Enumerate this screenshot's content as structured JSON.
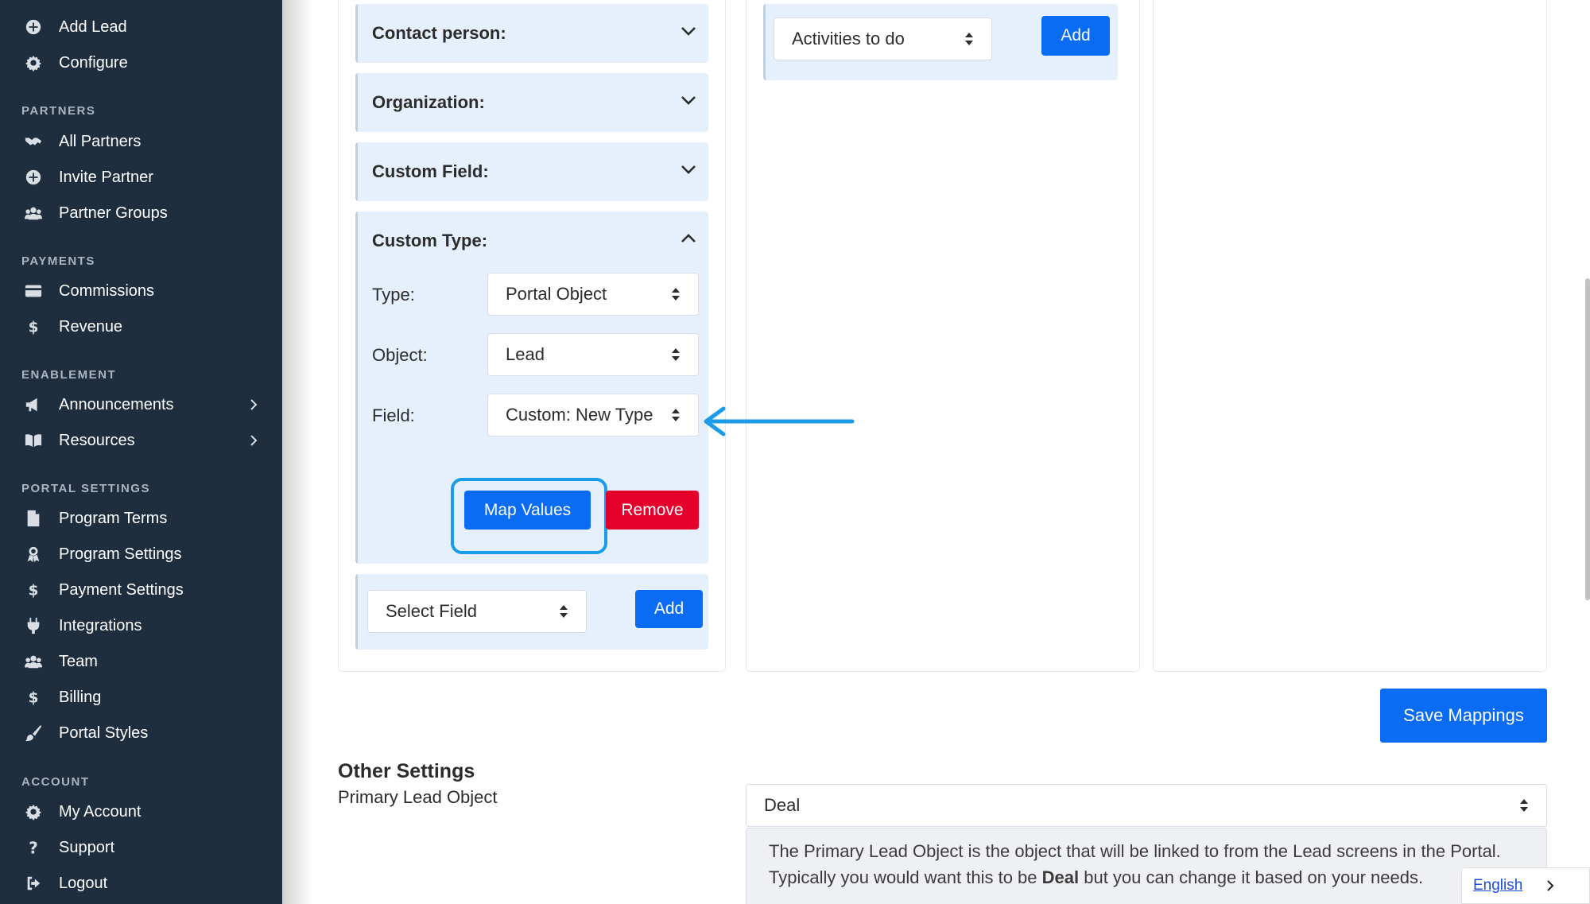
{
  "sidebar": {
    "top_items": [
      {
        "label": "Add Lead",
        "icon": "plus-circle-icon"
      },
      {
        "label": "Configure",
        "icon": "gear-icon"
      }
    ],
    "sections": [
      {
        "title": "PARTNERS",
        "items": [
          {
            "label": "All Partners",
            "icon": "handshake-icon"
          },
          {
            "label": "Invite Partner",
            "icon": "plus-circle-icon"
          },
          {
            "label": "Partner Groups",
            "icon": "users-icon"
          }
        ]
      },
      {
        "title": "PAYMENTS",
        "items": [
          {
            "label": "Commissions",
            "icon": "credit-card-icon"
          },
          {
            "label": "Revenue",
            "icon": "dollar-icon"
          }
        ]
      },
      {
        "title": "ENABLEMENT",
        "items": [
          {
            "label": "Announcements",
            "icon": "megaphone-icon"
          },
          {
            "label": "Resources",
            "icon": "book-icon"
          }
        ]
      },
      {
        "title": "PORTAL SETTINGS",
        "items": [
          {
            "label": "Program Terms",
            "icon": "file-icon"
          },
          {
            "label": "Program Settings",
            "icon": "award-icon"
          },
          {
            "label": "Payment Settings",
            "icon": "dollar-icon"
          },
          {
            "label": "Integrations",
            "icon": "plug-icon"
          },
          {
            "label": "Team",
            "icon": "users-icon"
          },
          {
            "label": "Billing",
            "icon": "dollar-icon"
          },
          {
            "label": "Portal Styles",
            "icon": "brush-icon"
          }
        ]
      },
      {
        "title": "ACCOUNT",
        "items": [
          {
            "label": "My Account",
            "icon": "gear-icon"
          },
          {
            "label": "Support",
            "icon": "question-icon"
          },
          {
            "label": "Logout",
            "icon": "logout-icon"
          }
        ]
      }
    ]
  },
  "mapping": {
    "accordions": {
      "contact_person": "Contact person:",
      "organization": "Organization:",
      "custom_field": "Custom Field:",
      "custom_type": "Custom Type:"
    },
    "custom_type": {
      "type_label": "Type:",
      "type_value": "Portal Object",
      "object_label": "Object:",
      "object_value": "Lead",
      "field_label": "Field:",
      "field_value": "Custom: New Type",
      "map_values_label": "Map Values",
      "remove_label": "Remove"
    },
    "select_field_value": "Select Field",
    "add_label": "Add",
    "activities_value": "Activities to do",
    "activities_add_label": "Add",
    "save_label": "Save Mappings"
  },
  "other_settings": {
    "heading": "Other Settings",
    "primary_label": "Primary Lead Object",
    "primary_value": "Deal",
    "description_pre": "The Primary Lead Object is the object that will be linked to from the Lead screens in the Portal. Typically you would want this to be ",
    "description_bold": "Deal",
    "description_post": " but you can change it based on your needs."
  },
  "language": {
    "label": "English"
  }
}
